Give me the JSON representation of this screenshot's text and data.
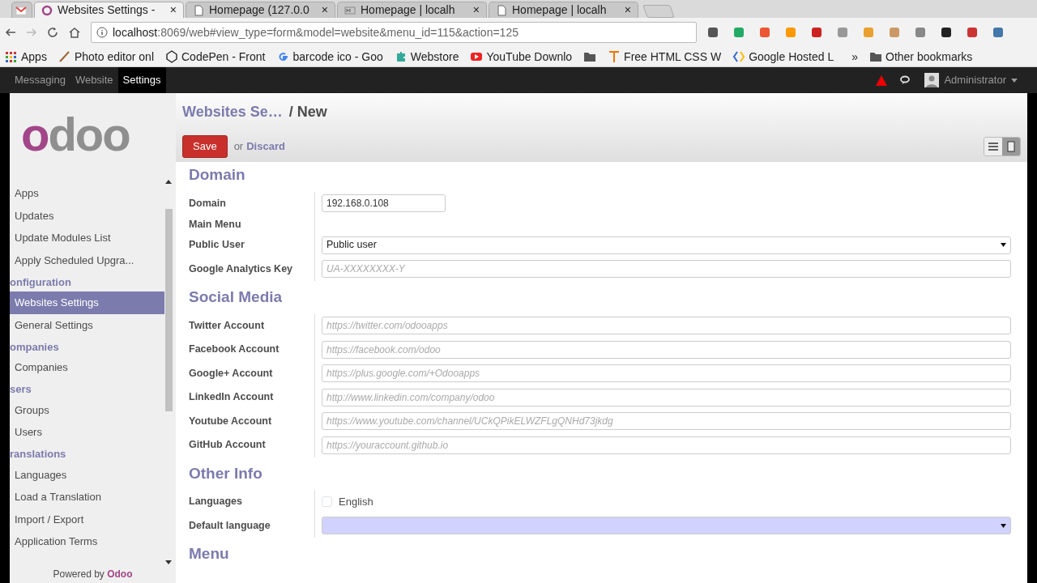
{
  "browser": {
    "tabs": [
      {
        "kind": "gmail",
        "selected": false
      },
      {
        "label": "Websites Settings -",
        "close": "×",
        "kind": "odoo",
        "selected": true
      },
      {
        "label": "Homepage (127.0.0",
        "close": "×",
        "kind": "page",
        "selected": false
      },
      {
        "label": "Homepage | localh",
        "close": "×",
        "kind": "m",
        "selected": false
      },
      {
        "label": "Homepage | localh",
        "close": "×",
        "kind": "page",
        "selected": false
      }
    ],
    "address": {
      "host": "localhost",
      "rest": ":8069/web#view_type=form&model=website&menu_id=115&action=125"
    },
    "bookmarks": [
      {
        "label": "Apps",
        "kind": "apps"
      },
      {
        "label": "Photo editor onl",
        "kind": "pen"
      },
      {
        "label": "CodePen - Front",
        "kind": "codepen"
      },
      {
        "label": "barcode ico - Goo",
        "kind": "google"
      },
      {
        "label": "Webstore",
        "kind": "puzzle"
      },
      {
        "label": "YouTube Downlo",
        "kind": "youtube"
      },
      {
        "kind": "folder"
      },
      {
        "label": "Free HTML CSS W",
        "kind": "t"
      },
      {
        "label": "Google Hosted L",
        "kind": "brackets"
      },
      {
        "label": "»",
        "kind": "more"
      },
      {
        "label": "Other bookmarks",
        "kind": "folder"
      }
    ]
  },
  "topbar": {
    "menus": [
      {
        "label": "Messaging",
        "selected": false
      },
      {
        "label": "Website",
        "selected": false
      },
      {
        "label": "Settings",
        "selected": true
      }
    ],
    "user": "Administrator"
  },
  "sidebar": {
    "logo": "odoo",
    "entries": [
      {
        "kind": "item",
        "label": "Apps",
        "selected": false
      },
      {
        "kind": "item",
        "label": "Updates",
        "selected": false
      },
      {
        "kind": "item",
        "label": "Update Modules List",
        "selected": false
      },
      {
        "kind": "item",
        "label": "Apply Scheduled Upgra...",
        "selected": false
      },
      {
        "kind": "header",
        "label": "onfiguration"
      },
      {
        "kind": "item",
        "label": "Websites Settings",
        "selected": true
      },
      {
        "kind": "item",
        "label": "General Settings",
        "selected": false
      },
      {
        "kind": "header",
        "label": "ompanies"
      },
      {
        "kind": "item",
        "label": "Companies",
        "selected": false
      },
      {
        "kind": "header",
        "label": "sers"
      },
      {
        "kind": "item",
        "label": "Groups",
        "selected": false
      },
      {
        "kind": "item",
        "label": "Users",
        "selected": false
      },
      {
        "kind": "header",
        "label": "ranslations"
      },
      {
        "kind": "item",
        "label": "Languages",
        "selected": false
      },
      {
        "kind": "item",
        "label": "Load a Translation",
        "selected": false
      },
      {
        "kind": "item",
        "label": "Import / Export",
        "selected": false
      },
      {
        "kind": "item",
        "label": "Application Terms",
        "selected": false
      }
    ],
    "footer": {
      "text": "Powered by",
      "brand": "Odoo"
    }
  },
  "form": {
    "breadcrumb": {
      "parent": "Websites Se…",
      "separator": "/",
      "current": "New"
    },
    "save": "Save",
    "or": "or",
    "discard": "Discard",
    "views": [
      {
        "kind": "list",
        "selected": false
      },
      {
        "kind": "form",
        "selected": true
      }
    ],
    "sections": [
      {
        "title": "Domain",
        "fields": [
          {
            "label": "Domain",
            "kind": "short",
            "value": "192.168.0.108"
          },
          {
            "label": "Main Menu",
            "kind": "none"
          },
          {
            "label": "Public User",
            "kind": "select",
            "value": "Public user",
            "required": false
          },
          {
            "label": "Google Analytics Key",
            "kind": "text",
            "placeholder": "UA-XXXXXXXX-Y"
          }
        ]
      },
      {
        "title": "Social Media",
        "fields": [
          {
            "label": "Twitter Account",
            "kind": "text",
            "placeholder": "https://twitter.com/odooapps"
          },
          {
            "label": "Facebook Account",
            "kind": "text",
            "placeholder": "https://facebook.com/odoo"
          },
          {
            "label": "Google+ Account",
            "kind": "text",
            "placeholder": "https://plus.google.com/+Odooapps"
          },
          {
            "label": "LinkedIn Account",
            "kind": "text",
            "placeholder": "http://www.linkedin.com/company/odoo"
          },
          {
            "label": "Youtube Account",
            "kind": "text",
            "placeholder": "https://www.youtube.com/channel/UCkQPikELWZFLgQNHd73jkdg"
          },
          {
            "label": "GitHub Account",
            "kind": "text",
            "placeholder": "https://youraccount.github.io"
          }
        ]
      },
      {
        "title": "Other Info",
        "fields": [
          {
            "label": "Languages",
            "kind": "checkbox",
            "option": "English",
            "checked": false
          },
          {
            "label": "Default language",
            "kind": "select",
            "required": true
          }
        ]
      },
      {
        "title": "Menu"
      }
    ]
  }
}
